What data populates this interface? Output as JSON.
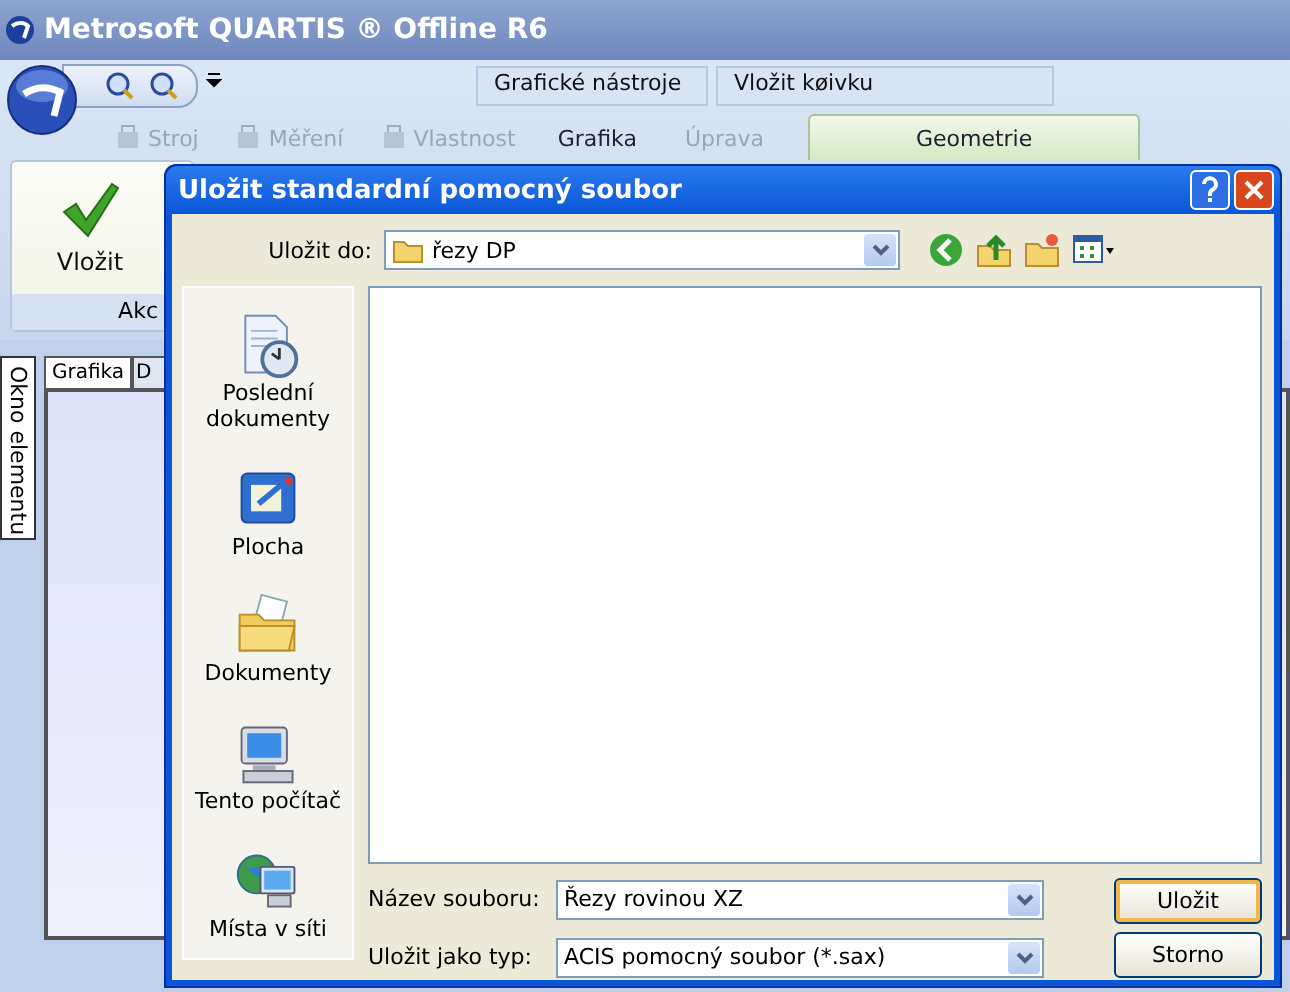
{
  "app": {
    "title": "Metrosoft QUARTIS ® Offline R6"
  },
  "contextual_groups": [
    {
      "label": "Grafické nástroje"
    },
    {
      "label": "Vložit køivku"
    }
  ],
  "ribbon_tabs": [
    {
      "label": "Stroj",
      "kind": "icon",
      "disabled": true,
      "selected": false
    },
    {
      "label": "Měření",
      "kind": "icon",
      "disabled": true,
      "selected": false
    },
    {
      "label": "Vlastnost",
      "kind": "icon",
      "disabled": true,
      "selected": false
    },
    {
      "label": "Grafika",
      "kind": "plain",
      "disabled": false,
      "selected": false
    },
    {
      "label": "Úprava",
      "kind": "plain",
      "disabled": true,
      "selected": false
    },
    {
      "label": "Geometrie",
      "kind": "plain",
      "disabled": false,
      "selected": true
    }
  ],
  "ribbon_panel": {
    "button": "Vložit",
    "group_label": "Akc"
  },
  "side_tab": "Okno elementu",
  "doc_tabs": [
    {
      "label": "Grafika",
      "selected": true
    },
    {
      "label": "D",
      "selected": false
    }
  ],
  "dialog": {
    "title": "Uložit standardní pomocný soubor",
    "save_in_label": "Uložit do:",
    "save_in_value": "řezy DP",
    "places": [
      {
        "label": "Poslední dokumenty",
        "kind": "recent"
      },
      {
        "label": "Plocha",
        "kind": "desktop"
      },
      {
        "label": "Dokumenty",
        "kind": "documents"
      },
      {
        "label": "Tento počítač",
        "kind": "computer"
      },
      {
        "label": "Místa v síti",
        "kind": "network"
      }
    ],
    "file_name_label": "Název souboru:",
    "file_name_value": "Řezy rovinou XZ",
    "file_type_label": "Uložit jako typ:",
    "file_type_value": "ACIS pomocný soubor (*.sax)",
    "buttons": [
      {
        "label": "Uložit",
        "default": true
      },
      {
        "label": "Storno",
        "default": false
      }
    ]
  }
}
